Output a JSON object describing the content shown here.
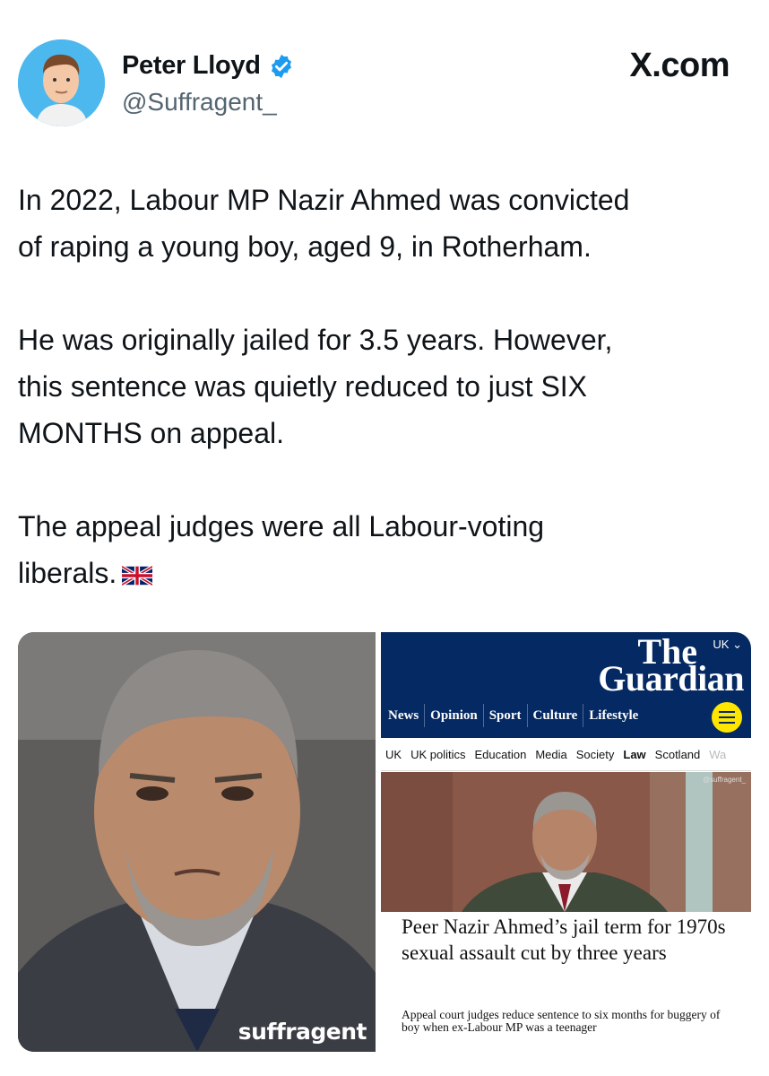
{
  "tweet": {
    "author_name": "Peter Lloyd",
    "author_handle": "@Suffragent_",
    "site": "X.com",
    "paragraphs": [
      "In 2022, Labour MP Nazir Ahmed was convicted\nof raping a young boy, aged 9, in Rotherham.",
      "He was originally jailed for 3.5 years.  However,\nthis sentence was quietly reduced to just SIX\nMONTHS on appeal.",
      "The appeal judges were all Labour-voting\nliberals."
    ],
    "flag_icon": "uk-flag-icon",
    "verified_icon": "verified-badge-icon"
  },
  "media": {
    "left_watermark": "suffragent",
    "guardian": {
      "edition": "UK",
      "logo_the": "The",
      "logo_guardian": "Guardian",
      "nav": [
        "News",
        "Opinion",
        "Sport",
        "Culture",
        "Lifestyle"
      ],
      "subnav": [
        "UK",
        "UK politics",
        "Education",
        "Media",
        "Society",
        "Law",
        "Scotland",
        "Wa"
      ],
      "photo_credit": "@suffragent_",
      "headline": "Peer Nazir Ahmed’s jail term for 1970s sexual assault cut by three years",
      "standfirst": "Appeal court judges reduce sentence to six months for buggery of boy when ex-Labour MP was a teenager"
    }
  },
  "colors": {
    "verified_blue": "#1d9bf0",
    "guardian_blue": "#052962",
    "guardian_yellow": "#ffe500",
    "avatar_bg": "#4cb8ee"
  }
}
